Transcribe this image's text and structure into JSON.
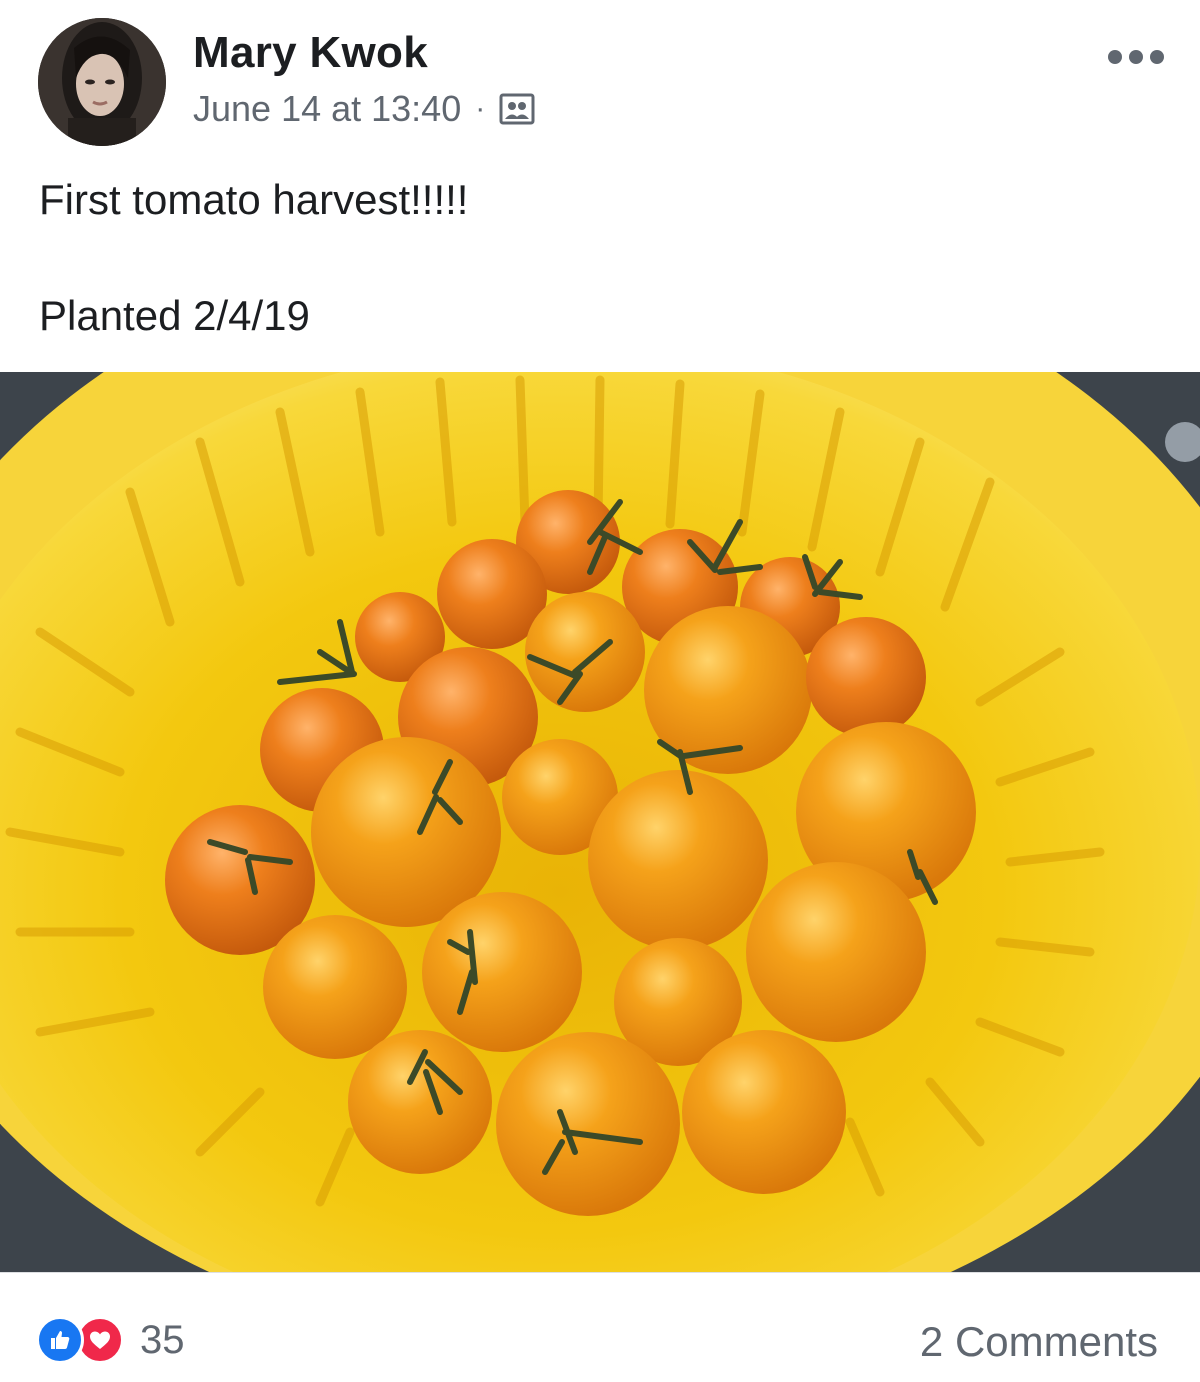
{
  "post": {
    "author": "Mary Kwok",
    "timestamp": "June 14 at 13:40",
    "separator": "·",
    "privacy_icon": "friends-icon",
    "more_icon": "more-options-icon",
    "text_line1": "First tomato harvest!!!!!",
    "text_line2": "Planted 2/4/19",
    "photo_description_icon": "photo"
  },
  "footer": {
    "reaction_icons": [
      "like-icon",
      "love-icon"
    ],
    "reaction_count": "35",
    "comments_label": "2 Comments"
  },
  "colors": {
    "like": "#1877f2",
    "love": "#f0284a",
    "text_secondary": "#606770",
    "colander": "#f2c20c",
    "tomato": "#f09a14"
  }
}
